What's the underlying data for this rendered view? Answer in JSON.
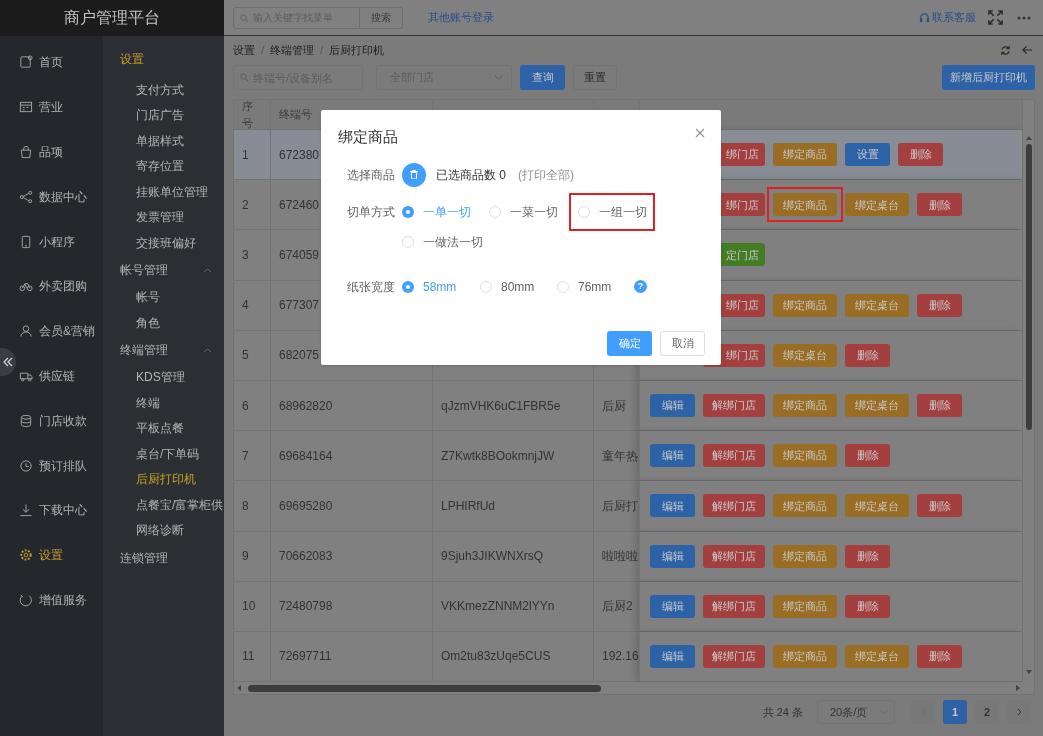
{
  "app_title": "商户管理平台",
  "nav": [
    {
      "label": "首页",
      "selected": false
    },
    {
      "label": "营业",
      "selected": false
    },
    {
      "label": "品项",
      "selected": false
    },
    {
      "label": "数据中心",
      "selected": false
    },
    {
      "label": "小程序",
      "selected": false
    },
    {
      "label": "外卖团购",
      "selected": false
    },
    {
      "label": "会员&营销",
      "selected": false
    },
    {
      "label": "供应链",
      "selected": false
    },
    {
      "label": "门店收款",
      "selected": false
    },
    {
      "label": "预订排队",
      "selected": false
    },
    {
      "label": "下载中心",
      "selected": false
    },
    {
      "label": "设置",
      "selected": true
    },
    {
      "label": "增值服务",
      "selected": false
    }
  ],
  "subnav": [
    {
      "label": "设置",
      "selected": true,
      "children": [
        {
          "label": "支付方式",
          "selected": false
        },
        {
          "label": "门店广告",
          "selected": false
        },
        {
          "label": "单据样式",
          "selected": false
        },
        {
          "label": "寄存位置",
          "selected": false
        },
        {
          "label": "挂账单位管理",
          "selected": false
        },
        {
          "label": "发票管理",
          "selected": false
        },
        {
          "label": "交接班偏好",
          "selected": false
        }
      ]
    },
    {
      "label": "帐号管理",
      "selected": false,
      "expanded": true,
      "children": [
        {
          "label": "帐号",
          "selected": false
        },
        {
          "label": "角色",
          "selected": false
        }
      ]
    },
    {
      "label": "终端管理",
      "selected": false,
      "expanded": true,
      "children": [
        {
          "label": "KDS管理",
          "selected": false
        },
        {
          "label": "终端",
          "selected": false
        },
        {
          "label": "平板点餐",
          "selected": false
        },
        {
          "label": "桌台/下单码",
          "selected": false
        },
        {
          "label": "后厨打印机",
          "selected": true
        },
        {
          "label": "点餐宝/富掌柜供",
          "selected": false
        },
        {
          "label": "网络诊断",
          "selected": false
        }
      ]
    },
    {
      "label": "连锁管理",
      "selected": false
    }
  ],
  "header": {
    "search_placeholder": "输入关键字找菜单",
    "search_button": "搜索",
    "link": "其他账号登录",
    "support": "联系客服"
  },
  "breadcrumb": {
    "separator": "/",
    "items": [
      "设置",
      "终端管理",
      "后厨打印机"
    ]
  },
  "filters": {
    "search_placeholder": "终端号/设备别名",
    "store_select": "全部门店",
    "query": "查询",
    "reset": "重置",
    "add": "新增后厨打印机"
  },
  "table": {
    "columns": [
      "序号",
      "终端号"
    ],
    "rows": [
      {
        "no": "1",
        "terminal": "672380",
        "selected": true,
        "covered": true,
        "actions": [
          {
            "kind": "unbind",
            "label": "绑门店",
            "highlighted": false
          },
          {
            "kind": "bind_goods",
            "label": "绑定商品",
            "highlighted": false
          },
          {
            "kind": "setting",
            "label": "设置",
            "highlighted": false
          },
          {
            "kind": "delete",
            "label": "删除",
            "highlighted": false
          }
        ]
      },
      {
        "no": "2",
        "terminal": "672460",
        "selected": false,
        "covered": true,
        "actions": [
          {
            "kind": "unbind",
            "label": "绑门店",
            "highlighted": false
          },
          {
            "kind": "bind_goods",
            "label": "绑定商品",
            "highlighted": true
          },
          {
            "kind": "bind_table",
            "label": "绑定桌台",
            "highlighted": false
          },
          {
            "kind": "delete",
            "label": "删除",
            "highlighted": false
          }
        ]
      },
      {
        "no": "3",
        "terminal": "674059",
        "selected": false,
        "covered": true,
        "actions": [
          {
            "kind": "bind_store",
            "label": "定门店",
            "highlighted": false
          }
        ]
      },
      {
        "no": "4",
        "terminal": "677307",
        "selected": false,
        "covered": true,
        "actions": [
          {
            "kind": "unbind",
            "label": "绑门店",
            "highlighted": false
          },
          {
            "kind": "bind_goods",
            "label": "绑定商品",
            "highlighted": false
          },
          {
            "kind": "bind_table",
            "label": "绑定桌台",
            "highlighted": false
          },
          {
            "kind": "delete",
            "label": "删除",
            "highlighted": false
          }
        ]
      },
      {
        "no": "5",
        "terminal": "682075",
        "selected": false,
        "covered": true,
        "actions": [
          {
            "kind": "unbind",
            "label": "绑门店",
            "highlighted": false
          },
          {
            "kind": "bind_table",
            "label": "绑定桌台",
            "highlighted": false
          },
          {
            "kind": "delete",
            "label": "删除",
            "highlighted": false
          }
        ]
      },
      {
        "no": "6",
        "terminal": "68962820",
        "column_3": "qJzmVHK6uC1FBR5e",
        "column_4": "后厨",
        "selected": false,
        "covered": false,
        "actions": [
          {
            "kind": "edit",
            "label": "编辑",
            "highlighted": false
          },
          {
            "kind": "unbind",
            "label": "解绑门店",
            "highlighted": false
          },
          {
            "kind": "bind_goods",
            "label": "绑定商品",
            "highlighted": false
          },
          {
            "kind": "bind_table",
            "label": "绑定桌台",
            "highlighted": false
          },
          {
            "kind": "delete",
            "label": "删除",
            "highlighted": false
          }
        ]
      },
      {
        "no": "7",
        "terminal": "69684164",
        "column_3": "Z7Kwtk8BOokmnjJW",
        "column_4": "童年热",
        "selected": false,
        "covered": false,
        "actions": [
          {
            "kind": "edit",
            "label": "编辑",
            "highlighted": false
          },
          {
            "kind": "unbind",
            "label": "解绑门店",
            "highlighted": false
          },
          {
            "kind": "bind_goods",
            "label": "绑定商品",
            "highlighted": false
          },
          {
            "kind": "delete",
            "label": "删除",
            "highlighted": false
          }
        ]
      },
      {
        "no": "8",
        "terminal": "69695280",
        "column_3": "LPHIRfUd",
        "column_4": "后厨打",
        "selected": false,
        "covered": false,
        "actions": [
          {
            "kind": "edit",
            "label": "编辑",
            "highlighted": false
          },
          {
            "kind": "unbind",
            "label": "解绑门店",
            "highlighted": false
          },
          {
            "kind": "bind_goods",
            "label": "绑定商品",
            "highlighted": false
          },
          {
            "kind": "bind_table",
            "label": "绑定桌台",
            "highlighted": false
          },
          {
            "kind": "delete",
            "label": "删除",
            "highlighted": false
          }
        ]
      },
      {
        "no": "9",
        "terminal": "70662083",
        "column_3": "9Sjuh3JIKWNXrsQ",
        "column_4": "啦啦啦",
        "selected": false,
        "covered": false,
        "actions": [
          {
            "kind": "edit",
            "label": "编辑",
            "highlighted": false
          },
          {
            "kind": "unbind",
            "label": "解绑门店",
            "highlighted": false
          },
          {
            "kind": "bind_goods",
            "label": "绑定商品",
            "highlighted": false
          },
          {
            "kind": "delete",
            "label": "删除",
            "highlighted": false
          }
        ]
      },
      {
        "no": "10",
        "terminal": "72480798",
        "column_3": "VKKmezZNNM2lYYn",
        "column_4": "后厨2",
        "selected": false,
        "covered": false,
        "actions": [
          {
            "kind": "edit",
            "label": "编辑",
            "highlighted": false
          },
          {
            "kind": "unbind",
            "label": "解绑门店",
            "highlighted": false
          },
          {
            "kind": "bind_goods",
            "label": "绑定商品",
            "highlighted": false
          },
          {
            "kind": "delete",
            "label": "删除",
            "highlighted": false
          }
        ]
      },
      {
        "no": "11",
        "terminal": "72697711",
        "column_3": "Om2tu83zUqe5CUS",
        "column_4": "192.16",
        "selected": false,
        "covered": false,
        "actions": [
          {
            "kind": "edit",
            "label": "编辑",
            "highlighted": false
          },
          {
            "kind": "unbind",
            "label": "解绑门店",
            "highlighted": false
          },
          {
            "kind": "bind_goods",
            "label": "绑定商品",
            "highlighted": false
          },
          {
            "kind": "bind_table",
            "label": "绑定桌台",
            "highlighted": false
          },
          {
            "kind": "delete",
            "label": "删除",
            "highlighted": false
          }
        ]
      }
    ]
  },
  "pagination": {
    "total": "共 24 条",
    "page_size": "20条/页",
    "pages": [
      {
        "label": "1",
        "selected": true
      },
      {
        "label": "2",
        "selected": false
      }
    ]
  },
  "dialog": {
    "title": "绑定商品",
    "goods_label": "选择商品",
    "goods_count": "已选商品数 0",
    "goods_note": "(打印全部)",
    "cut_label": "切单方式",
    "cut_options": [
      {
        "label": "一单一切",
        "selected": true,
        "highlighted": false
      },
      {
        "label": "一菜一切",
        "selected": false,
        "highlighted": false
      },
      {
        "label": "一组一切",
        "selected": false,
        "highlighted": true
      },
      {
        "label": "一做法一切",
        "selected": false,
        "highlighted": false
      }
    ],
    "paper_label": "纸张宽度",
    "paper_options": [
      {
        "label": "58mm",
        "selected": true
      },
      {
        "label": "80mm",
        "selected": false
      },
      {
        "label": "76mm",
        "selected": false
      }
    ],
    "help": "?",
    "confirm": "确定",
    "cancel": "取消"
  }
}
